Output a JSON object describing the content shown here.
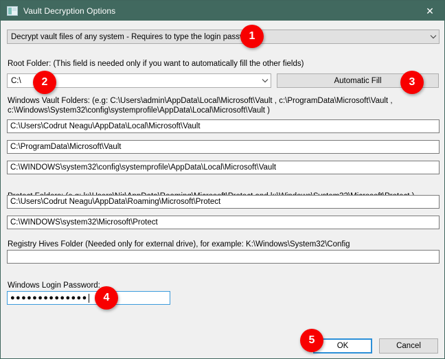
{
  "window": {
    "title": "Vault Decryption Options",
    "icon": "app-window-icon",
    "close_label": "✕",
    "titlebar_color": "#41695f",
    "body_color": "#f0f0f0"
  },
  "mode_combo": {
    "value": "Decrypt vault files of any system - Requires to type the login password"
  },
  "root_folder": {
    "label": "Root Folder: (This field is needed only if you want to automatically fill the other fields)",
    "value": "C:\\"
  },
  "automatic_fill": {
    "label": "Automatic Fill"
  },
  "vault_folders": {
    "label_line1": "Windows Vault Folders:  (e.g: C:\\Users\\admin\\AppData\\Local\\Microsoft\\Vault , c:\\ProgramData\\Microsoft\\Vault ,",
    "label_line2": "c:\\Windows\\System32\\config\\systemprofile\\AppData\\Local\\Microsoft\\Vault )",
    "values": [
      "C:\\Users\\Codrut Neagu\\AppData\\Local\\Microsoft\\Vault",
      "C:\\ProgramData\\Microsoft\\Vault",
      "C:\\WINDOWS\\system32\\config\\systemprofile\\AppData\\Local\\Microsoft\\Vault"
    ]
  },
  "protect_folders": {
    "label": "Protect Folders: (e.g: k:\\Users\\Nir\\AppData\\Roaming\\Microsoft\\Protect and k:\\Windows\\System32\\Microsoft\\Protect )",
    "values": [
      "C:\\Users\\Codrut Neagu\\AppData\\Roaming\\Microsoft\\Protect",
      "C:\\WINDOWS\\system32\\Microsoft\\Protect"
    ]
  },
  "registry_hives": {
    "label": "Registry Hives Folder (Needed only for external drive), for example:  K:\\Windows\\System32\\Config",
    "value": ""
  },
  "password": {
    "label": "Windows Login Password:",
    "value": "●●●●●●●●●●●●●●"
  },
  "buttons": {
    "ok": "OK",
    "cancel": "Cancel"
  },
  "badges": [
    {
      "number": "1"
    },
    {
      "number": "2"
    },
    {
      "number": "3"
    },
    {
      "number": "4"
    },
    {
      "number": "5"
    }
  ],
  "colors": {
    "badge": "#f80000",
    "accent": "#2b8fd8",
    "titlebar": "#41695f"
  }
}
